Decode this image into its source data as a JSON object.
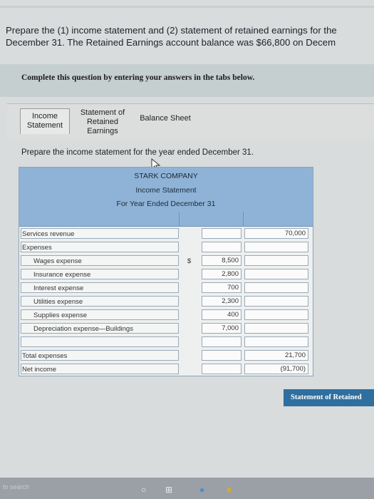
{
  "prompt": {
    "line1": "Prepare the (1) income statement and (2) statement of retained earnings for the",
    "line2": "December 31. The Retained Earnings account balance was $66,800 on Decem"
  },
  "instruction": "Complete this question by entering your answers in the tabs below.",
  "tabs": [
    {
      "label_line1": "Income",
      "label_line2": "Statement",
      "label_line3": ""
    },
    {
      "label_line1": "Statement of",
      "label_line2": "Retained",
      "label_line3": "Earnings"
    },
    {
      "label_line1": "Balance Sheet",
      "label_line2": "",
      "label_line3": ""
    }
  ],
  "subprompt": "Prepare the income statement for the year ended December 31.",
  "statement": {
    "company": "STARK COMPANY",
    "title": "Income Statement",
    "period": "For Year Ended December 31",
    "rows": [
      {
        "label": "Services revenue",
        "mid": "",
        "right": "70,000",
        "mid_currency": "",
        "right_currency": ""
      },
      {
        "label": "Expenses",
        "mid": "",
        "right": "",
        "mid_currency": "",
        "right_currency": ""
      },
      {
        "label": "Wages expense",
        "mid": "8,500",
        "right": "",
        "mid_currency": "$",
        "right_currency": ""
      },
      {
        "label": "Insurance expense",
        "mid": "2,800",
        "right": "",
        "mid_currency": "",
        "right_currency": ""
      },
      {
        "label": "Interest expense",
        "mid": "700",
        "right": "",
        "mid_currency": "",
        "right_currency": ""
      },
      {
        "label": "Utilities expense",
        "mid": "2,300",
        "right": "",
        "mid_currency": "",
        "right_currency": ""
      },
      {
        "label": "Supplies expense",
        "mid": "400",
        "right": "",
        "mid_currency": "",
        "right_currency": ""
      },
      {
        "label": "Depreciation expense—Buildings",
        "mid": "7,000",
        "right": "",
        "mid_currency": "",
        "right_currency": ""
      },
      {
        "label": "",
        "mid": "",
        "right": "",
        "mid_currency": "",
        "right_currency": ""
      },
      {
        "label": "Total expenses",
        "mid": "",
        "right": "21,700",
        "mid_currency": "",
        "right_currency": ""
      },
      {
        "label": "Net income",
        "mid": "",
        "right": "(91,700)",
        "mid_currency": "",
        "right_currency": "$"
      }
    ]
  },
  "next_button": "Statement of Retained",
  "taskbar": {
    "search": "to search"
  },
  "colors": {
    "header_blue": "#8fb3d6",
    "button_blue": "#2f6f9f"
  }
}
